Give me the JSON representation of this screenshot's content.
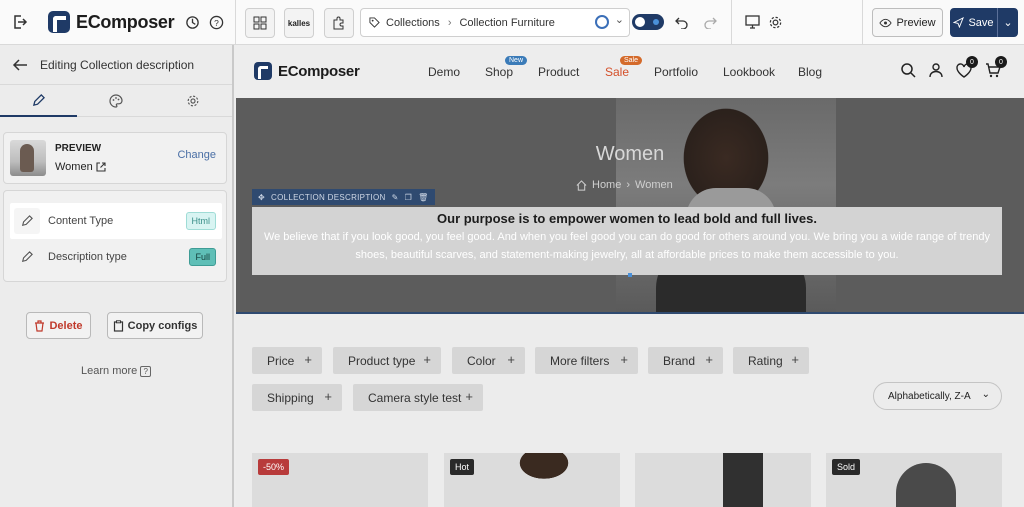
{
  "app": {
    "logo_text": "EComposer",
    "templates_label": "kalles",
    "breadcrumb": [
      "Collections",
      "Collection Furniture"
    ],
    "preview_label": "Preview",
    "save_label": "Save"
  },
  "panel": {
    "title": "Editing Collection description",
    "tabs": [
      "pencil-icon",
      "palette-icon",
      "gear-icon"
    ],
    "preview": {
      "label": "PREVIEW",
      "name": "Women",
      "change_label": "Change"
    },
    "settings": [
      {
        "label": "Content Type",
        "badge": "Html"
      },
      {
        "label": "Description type",
        "badge": "Full"
      }
    ],
    "delete_label": "Delete",
    "copy_label": "Copy configs",
    "learn_more": "Learn more"
  },
  "store": {
    "logo_text": "EComposer",
    "nav": [
      {
        "label": "Demo"
      },
      {
        "label": "Shop",
        "tag": "New"
      },
      {
        "label": "Product"
      },
      {
        "label": "Sale",
        "tag": "Sale"
      },
      {
        "label": "Portfolio"
      },
      {
        "label": "Lookbook"
      },
      {
        "label": "Blog"
      }
    ],
    "wishlist_count": "0",
    "cart_count": "0",
    "hero_title": "Women",
    "hero_crumb_home": "Home",
    "hero_crumb_current": "Women",
    "selection_label": "COLLECTION DESCRIPTION",
    "desc_title": "Our purpose is to empower women to lead bold and full lives.",
    "desc_body": "We believe that if you look good, you feel good. And when you feel good you can do good for others around you. We bring you a wide range of trendy shoes, beautiful scarves, and statement-making jewelry, all at affordable prices to make them accessible to you.",
    "filters": [
      "Price",
      "Product type",
      "Color",
      "More filters",
      "Brand",
      "Rating",
      "Shipping",
      "Camera style test"
    ],
    "sort_value": "Alphabetically, Z-A",
    "product_badges": [
      "-50%",
      "Hot",
      "",
      "Sold"
    ]
  },
  "colors": {
    "brand": "#1f3a66",
    "accent_teal": "#5fbfb7",
    "sale": "#d4502a",
    "delete": "#c0392b"
  }
}
